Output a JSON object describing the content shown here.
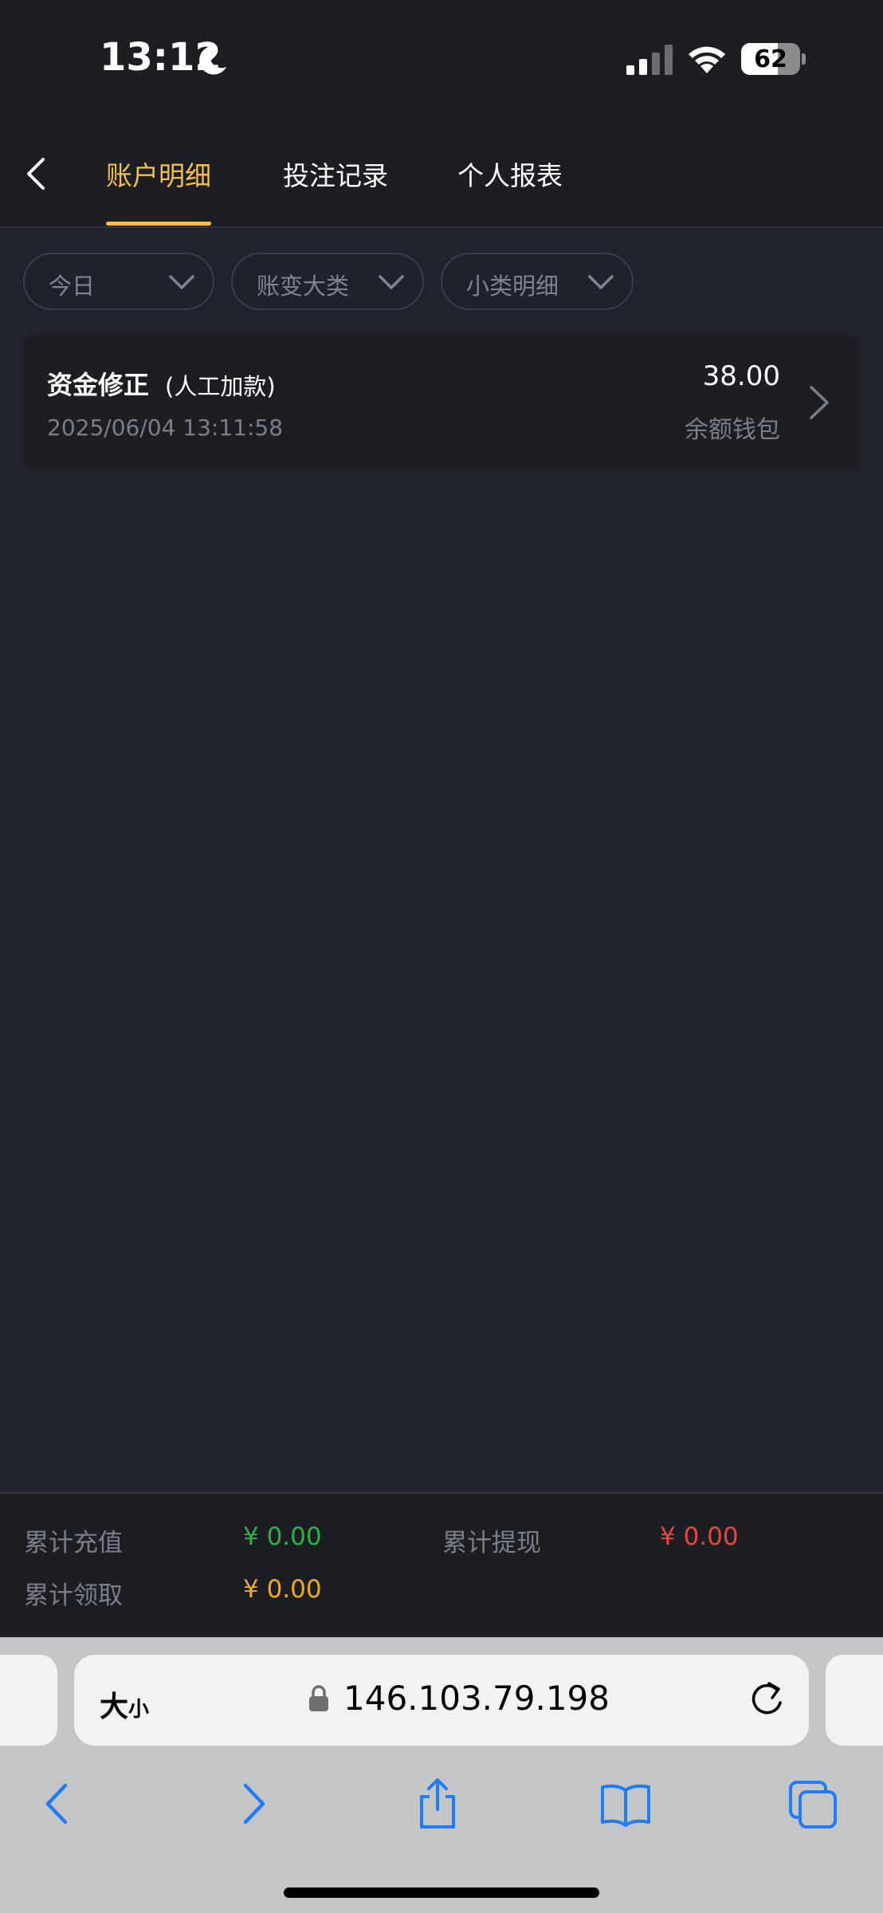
{
  "status_bar": {
    "time": "13:12",
    "battery_level": "62",
    "battery_fraction": 0.62
  },
  "header": {
    "tabs": [
      {
        "label": "账户明细",
        "active": true
      },
      {
        "label": "投注记录",
        "active": false
      },
      {
        "label": "个人报表",
        "active": false
      }
    ],
    "accent_color": "#f2c04b"
  },
  "filters": [
    {
      "label": "今日"
    },
    {
      "label": "账变大类"
    },
    {
      "label": "小类明细"
    }
  ],
  "records": [
    {
      "title": "资金修正",
      "subtitle": "(人工加款)",
      "datetime": "2025/06/04 13:11:58",
      "amount": "38.00",
      "wallet": "余额钱包"
    }
  ],
  "summary": {
    "recharge_label": "累计充值",
    "recharge_value": "¥ 0.00",
    "recharge_color": "#2bb341",
    "withdraw_label": "累计提现",
    "withdraw_value": "¥ 0.00",
    "withdraw_color": "#e8473b",
    "claim_label": "累计领取",
    "claim_value": "¥ 0.00",
    "claim_color": "#f2a91c"
  },
  "browser": {
    "text_size_big": "大",
    "text_size_small": "小",
    "url": "146.103.79.198",
    "nav_icons": [
      "back-icon",
      "forward-icon",
      "share-icon",
      "bookmarks-icon",
      "tabs-icon"
    ]
  }
}
